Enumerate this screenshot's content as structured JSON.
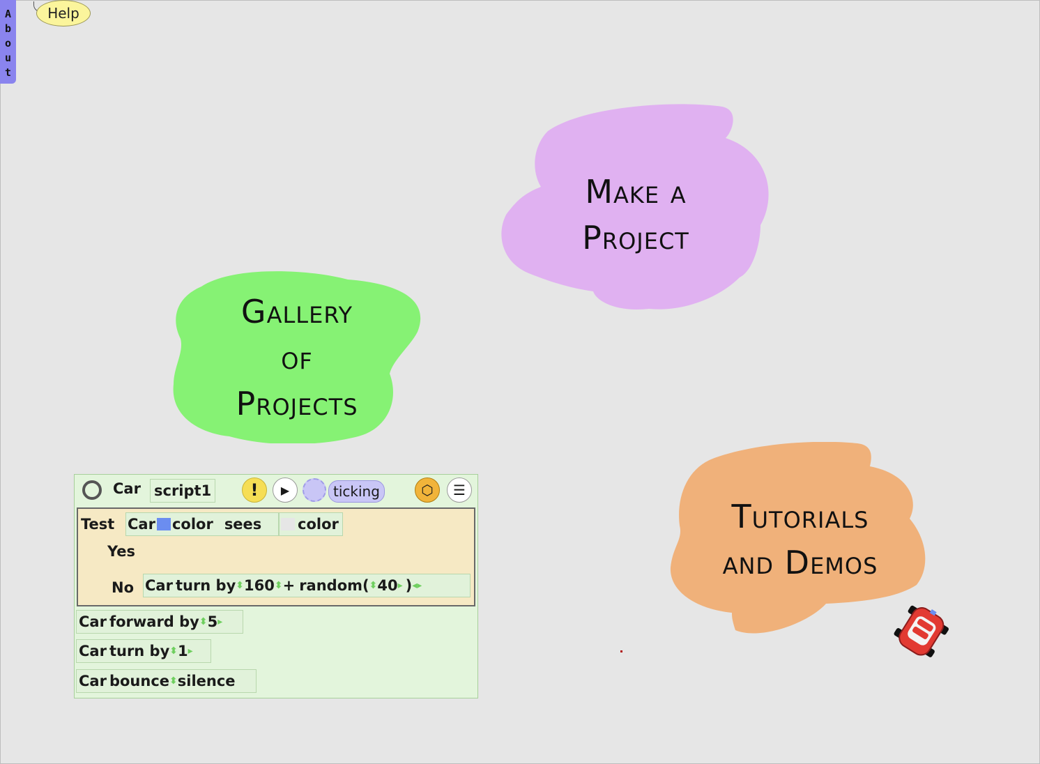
{
  "about_tab": {
    "letters": [
      "A",
      "b",
      "o",
      "u",
      "t"
    ]
  },
  "help": {
    "label": "Help"
  },
  "clouds": {
    "make_project": {
      "lines": [
        "Make a",
        "Project"
      ],
      "color": "#e0b1f1"
    },
    "gallery": {
      "lines": [
        "Gallery",
        "of",
        "Projects"
      ],
      "color": "#86f274"
    },
    "tutorials": {
      "lines": [
        "Tutorials",
        "and Demos"
      ],
      "color": "#f0b17a"
    }
  },
  "script": {
    "object": "Car",
    "name": "script1",
    "status": "ticking",
    "test": {
      "test_label": "Test",
      "object": "Car",
      "color_label": "color",
      "sees_label": "sees",
      "color2_label": "color",
      "swatch_color": "#6b8df0",
      "swatch2_color": "#e6e6e6",
      "yes_label": "Yes",
      "no_label": "No",
      "no_object": "Car",
      "no_command": "turn by",
      "no_value": "160",
      "plus": "+",
      "random_label": "random",
      "open_paren": "(",
      "random_value": "40",
      "close_paren": ")"
    },
    "lines": [
      {
        "object": "Car",
        "command": "forward by",
        "value": "5"
      },
      {
        "object": "Car",
        "command": "turn by",
        "value": "1"
      },
      {
        "object": "Car",
        "command": "bounce",
        "value": "silence"
      }
    ]
  },
  "colors": {
    "script_bg": "#e3f5dc",
    "test_bg": "#f6e9c4",
    "about_tab": "#8a84ee",
    "help_balloon": "#fbf59c",
    "car": "#e23a32"
  }
}
